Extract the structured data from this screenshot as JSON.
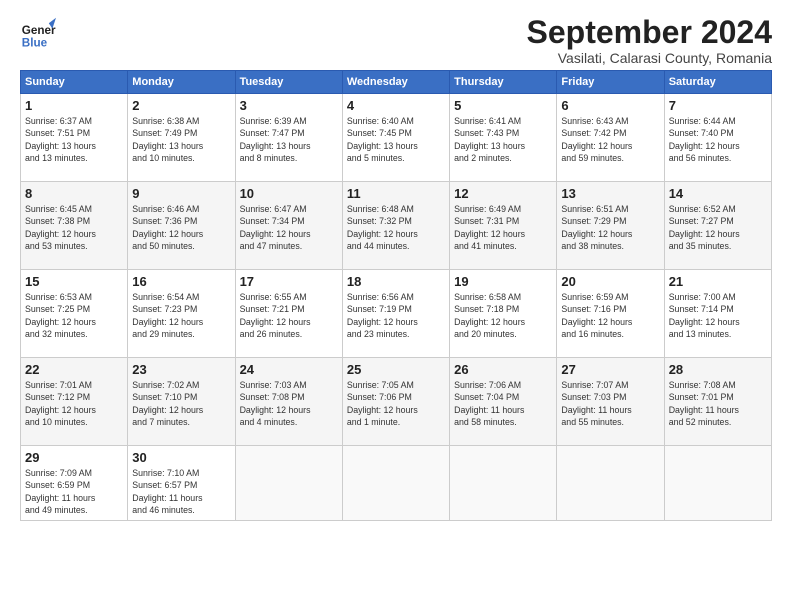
{
  "header": {
    "logo_line1": "General",
    "logo_line2": "Blue",
    "month_year": "September 2024",
    "location": "Vasilati, Calarasi County, Romania"
  },
  "weekdays": [
    "Sunday",
    "Monday",
    "Tuesday",
    "Wednesday",
    "Thursday",
    "Friday",
    "Saturday"
  ],
  "weeks": [
    [
      {
        "day": "1",
        "details": "Sunrise: 6:37 AM\nSunset: 7:51 PM\nDaylight: 13 hours\nand 13 minutes."
      },
      {
        "day": "2",
        "details": "Sunrise: 6:38 AM\nSunset: 7:49 PM\nDaylight: 13 hours\nand 10 minutes."
      },
      {
        "day": "3",
        "details": "Sunrise: 6:39 AM\nSunset: 7:47 PM\nDaylight: 13 hours\nand 8 minutes."
      },
      {
        "day": "4",
        "details": "Sunrise: 6:40 AM\nSunset: 7:45 PM\nDaylight: 13 hours\nand 5 minutes."
      },
      {
        "day": "5",
        "details": "Sunrise: 6:41 AM\nSunset: 7:43 PM\nDaylight: 13 hours\nand 2 minutes."
      },
      {
        "day": "6",
        "details": "Sunrise: 6:43 AM\nSunset: 7:42 PM\nDaylight: 12 hours\nand 59 minutes."
      },
      {
        "day": "7",
        "details": "Sunrise: 6:44 AM\nSunset: 7:40 PM\nDaylight: 12 hours\nand 56 minutes."
      }
    ],
    [
      {
        "day": "8",
        "details": "Sunrise: 6:45 AM\nSunset: 7:38 PM\nDaylight: 12 hours\nand 53 minutes."
      },
      {
        "day": "9",
        "details": "Sunrise: 6:46 AM\nSunset: 7:36 PM\nDaylight: 12 hours\nand 50 minutes."
      },
      {
        "day": "10",
        "details": "Sunrise: 6:47 AM\nSunset: 7:34 PM\nDaylight: 12 hours\nand 47 minutes."
      },
      {
        "day": "11",
        "details": "Sunrise: 6:48 AM\nSunset: 7:32 PM\nDaylight: 12 hours\nand 44 minutes."
      },
      {
        "day": "12",
        "details": "Sunrise: 6:49 AM\nSunset: 7:31 PM\nDaylight: 12 hours\nand 41 minutes."
      },
      {
        "day": "13",
        "details": "Sunrise: 6:51 AM\nSunset: 7:29 PM\nDaylight: 12 hours\nand 38 minutes."
      },
      {
        "day": "14",
        "details": "Sunrise: 6:52 AM\nSunset: 7:27 PM\nDaylight: 12 hours\nand 35 minutes."
      }
    ],
    [
      {
        "day": "15",
        "details": "Sunrise: 6:53 AM\nSunset: 7:25 PM\nDaylight: 12 hours\nand 32 minutes."
      },
      {
        "day": "16",
        "details": "Sunrise: 6:54 AM\nSunset: 7:23 PM\nDaylight: 12 hours\nand 29 minutes."
      },
      {
        "day": "17",
        "details": "Sunrise: 6:55 AM\nSunset: 7:21 PM\nDaylight: 12 hours\nand 26 minutes."
      },
      {
        "day": "18",
        "details": "Sunrise: 6:56 AM\nSunset: 7:19 PM\nDaylight: 12 hours\nand 23 minutes."
      },
      {
        "day": "19",
        "details": "Sunrise: 6:58 AM\nSunset: 7:18 PM\nDaylight: 12 hours\nand 20 minutes."
      },
      {
        "day": "20",
        "details": "Sunrise: 6:59 AM\nSunset: 7:16 PM\nDaylight: 12 hours\nand 16 minutes."
      },
      {
        "day": "21",
        "details": "Sunrise: 7:00 AM\nSunset: 7:14 PM\nDaylight: 12 hours\nand 13 minutes."
      }
    ],
    [
      {
        "day": "22",
        "details": "Sunrise: 7:01 AM\nSunset: 7:12 PM\nDaylight: 12 hours\nand 10 minutes."
      },
      {
        "day": "23",
        "details": "Sunrise: 7:02 AM\nSunset: 7:10 PM\nDaylight: 12 hours\nand 7 minutes."
      },
      {
        "day": "24",
        "details": "Sunrise: 7:03 AM\nSunset: 7:08 PM\nDaylight: 12 hours\nand 4 minutes."
      },
      {
        "day": "25",
        "details": "Sunrise: 7:05 AM\nSunset: 7:06 PM\nDaylight: 12 hours\nand 1 minute."
      },
      {
        "day": "26",
        "details": "Sunrise: 7:06 AM\nSunset: 7:04 PM\nDaylight: 11 hours\nand 58 minutes."
      },
      {
        "day": "27",
        "details": "Sunrise: 7:07 AM\nSunset: 7:03 PM\nDaylight: 11 hours\nand 55 minutes."
      },
      {
        "day": "28",
        "details": "Sunrise: 7:08 AM\nSunset: 7:01 PM\nDaylight: 11 hours\nand 52 minutes."
      }
    ],
    [
      {
        "day": "29",
        "details": "Sunrise: 7:09 AM\nSunset: 6:59 PM\nDaylight: 11 hours\nand 49 minutes."
      },
      {
        "day": "30",
        "details": "Sunrise: 7:10 AM\nSunset: 6:57 PM\nDaylight: 11 hours\nand 46 minutes."
      },
      {
        "day": "",
        "details": ""
      },
      {
        "day": "",
        "details": ""
      },
      {
        "day": "",
        "details": ""
      },
      {
        "day": "",
        "details": ""
      },
      {
        "day": "",
        "details": ""
      }
    ]
  ]
}
